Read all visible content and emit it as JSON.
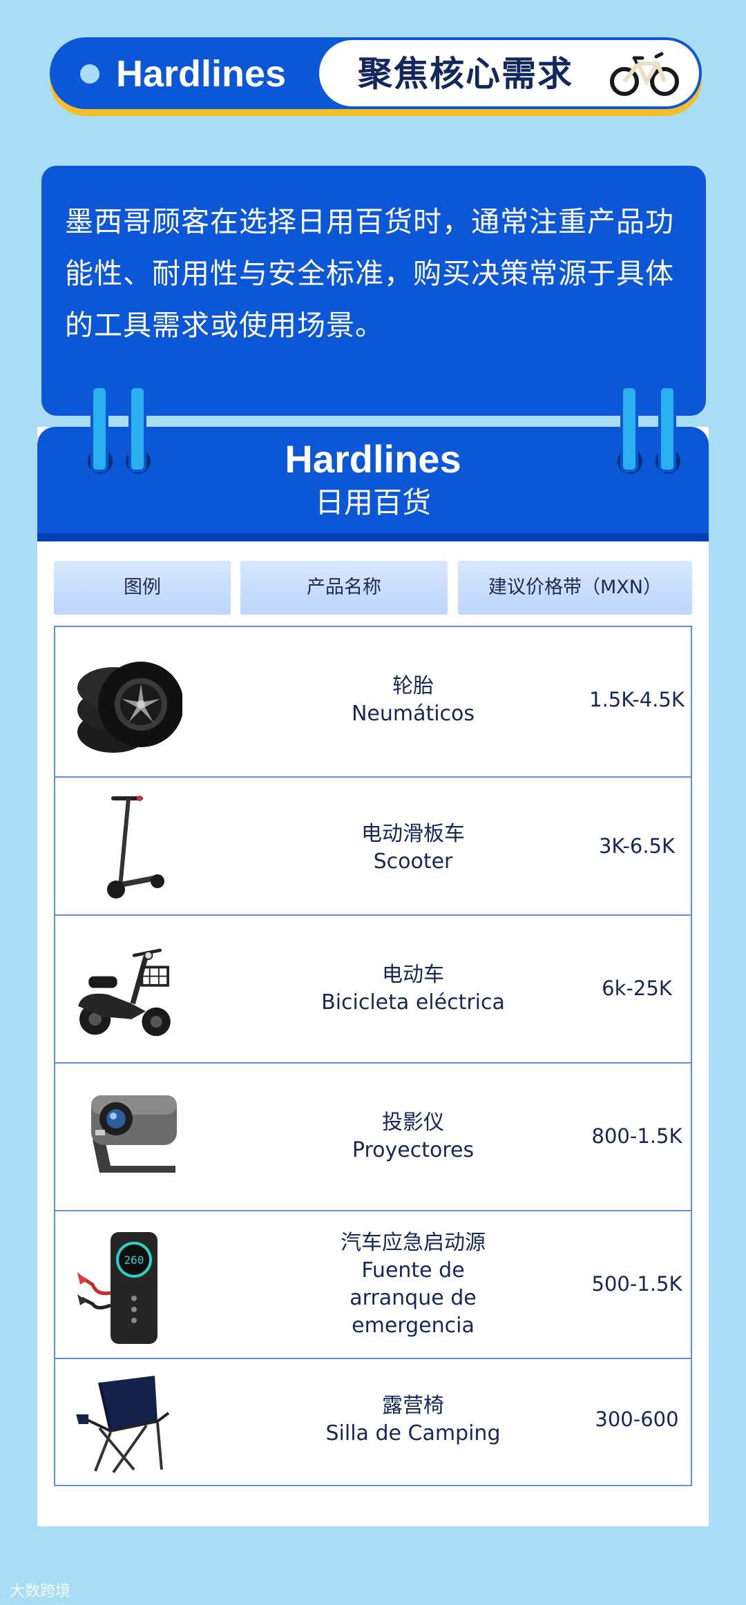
{
  "header": {
    "title": "Hardlines",
    "subtitle": "聚焦核心需求",
    "icon": "bicycle-icon"
  },
  "intro": {
    "text": "墨西哥顾客在选择日用百货时，通常注重产品功能性、耐用性与安全标准，购买决策常源于具体的工具需求或使用场景。"
  },
  "card": {
    "title": "Hardlines",
    "subtitle": "日用百货"
  },
  "table": {
    "columns": [
      "图例",
      "产品名称",
      "建议价格带（MXN）"
    ],
    "rows": [
      {
        "icon": "tire-icon",
        "name_cn": "轮胎",
        "name_es": "Neumáticos",
        "price": "1.5K-4.5K"
      },
      {
        "icon": "scooter-icon",
        "name_cn": "电动滑板车",
        "name_es": "Scooter",
        "price": "3K-6.5K"
      },
      {
        "icon": "e-bike-icon",
        "name_cn": "电动车",
        "name_es": "Bicicleta eléctrica",
        "price": "6k-25K"
      },
      {
        "icon": "projector-icon",
        "name_cn": "投影仪",
        "name_es": "Proyectores",
        "price": "800-1.5K"
      },
      {
        "icon": "jump-starter-icon",
        "name_cn": "汽车应急启动源",
        "name_es": "Fuente de arranque de emergencia",
        "price": "500-1.5K"
      },
      {
        "icon": "camping-chair-icon",
        "name_cn": "露营椅",
        "name_es": "Silla de Camping",
        "price": "300-600"
      }
    ]
  },
  "footer": {
    "watermark": "大数跨境"
  },
  "colors": {
    "background": "#a9dcf5",
    "primary_blue": "#0b57d6",
    "accent_yellow": "#f5be2a",
    "text_dark": "#15275a"
  }
}
